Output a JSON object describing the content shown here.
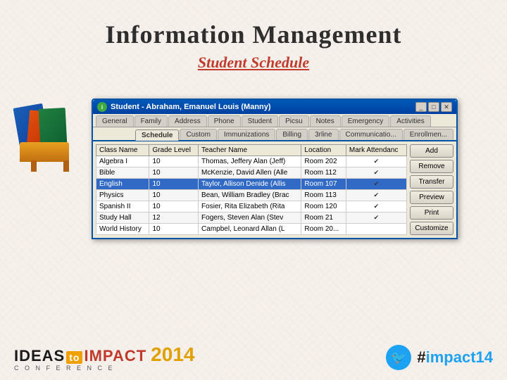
{
  "page": {
    "title": "Information Management",
    "subtitle": "Student Schedule"
  },
  "dialog": {
    "title": "Student - Abraham, Emanuel Louis (Manny)",
    "icon_label": "i",
    "controls": [
      "_",
      "□",
      "X"
    ]
  },
  "tabs_row1": [
    {
      "label": "General",
      "active": false
    },
    {
      "label": "Family",
      "active": false
    },
    {
      "label": "Address",
      "active": false
    },
    {
      "label": "Phone",
      "active": false
    },
    {
      "label": "Student",
      "active": false
    },
    {
      "label": "Picsu",
      "active": false
    },
    {
      "label": "Notes",
      "active": false
    },
    {
      "label": "Emergency",
      "active": false
    },
    {
      "label": "Activities",
      "active": false
    }
  ],
  "tabs_row2": [
    {
      "label": "Schedule",
      "active": true
    },
    {
      "label": "Custom",
      "active": false
    },
    {
      "label": "Immunizations",
      "active": false
    },
    {
      "label": "Billing",
      "active": false
    },
    {
      "label": "3rline",
      "active": false
    },
    {
      "label": "Communicatio...",
      "active": false
    },
    {
      "label": "Enrollmen...",
      "active": false
    }
  ],
  "table": {
    "headers": [
      "Class Name",
      "Grade Level",
      "Teacher Name",
      "Location",
      "Mark Attendanc"
    ],
    "rows": [
      {
        "class": "Algebra I",
        "grade": "10",
        "teacher": "Thomas, Jeffery Alan (Jeff)",
        "room": "Room 202",
        "checked": true,
        "selected": false
      },
      {
        "class": "Bible",
        "grade": "10",
        "teacher": "McKenzie, David Allen (Alle",
        "room": "Room 112",
        "checked": true,
        "selected": false
      },
      {
        "class": "English",
        "grade": "10",
        "teacher": "Taylor, Allison Denide (Allis",
        "room": "Room 107",
        "checked": true,
        "selected": true
      },
      {
        "class": "Physics",
        "grade": "10",
        "teacher": "Bean, William Bradley (Brac",
        "room": "Room 113",
        "checked": true,
        "selected": false
      },
      {
        "class": "Spanish II",
        "grade": "10",
        "teacher": "Fosier, Rita Elizabeth (Rita",
        "room": "Room 120",
        "checked": true,
        "selected": false
      },
      {
        "class": "Study Hall",
        "grade": "12",
        "teacher": "Fogers, Steven Alan (Stev",
        "room": "Room 21",
        "checked": true,
        "selected": false
      },
      {
        "class": "World History",
        "grade": "10",
        "teacher": "Campbel, Leonard Allan (L",
        "room": "Room 20...",
        "checked": false,
        "selected": false
      }
    ]
  },
  "buttons": [
    "Add",
    "Remove",
    "Transfer",
    "Preview",
    "Print",
    "Customize"
  ],
  "logo": {
    "ideas": "IDEAS",
    "to": "to",
    "impact": "IMPACT",
    "year": "2014",
    "conference": "C O N F E R E N C E",
    "hashtag": "#impact14"
  }
}
